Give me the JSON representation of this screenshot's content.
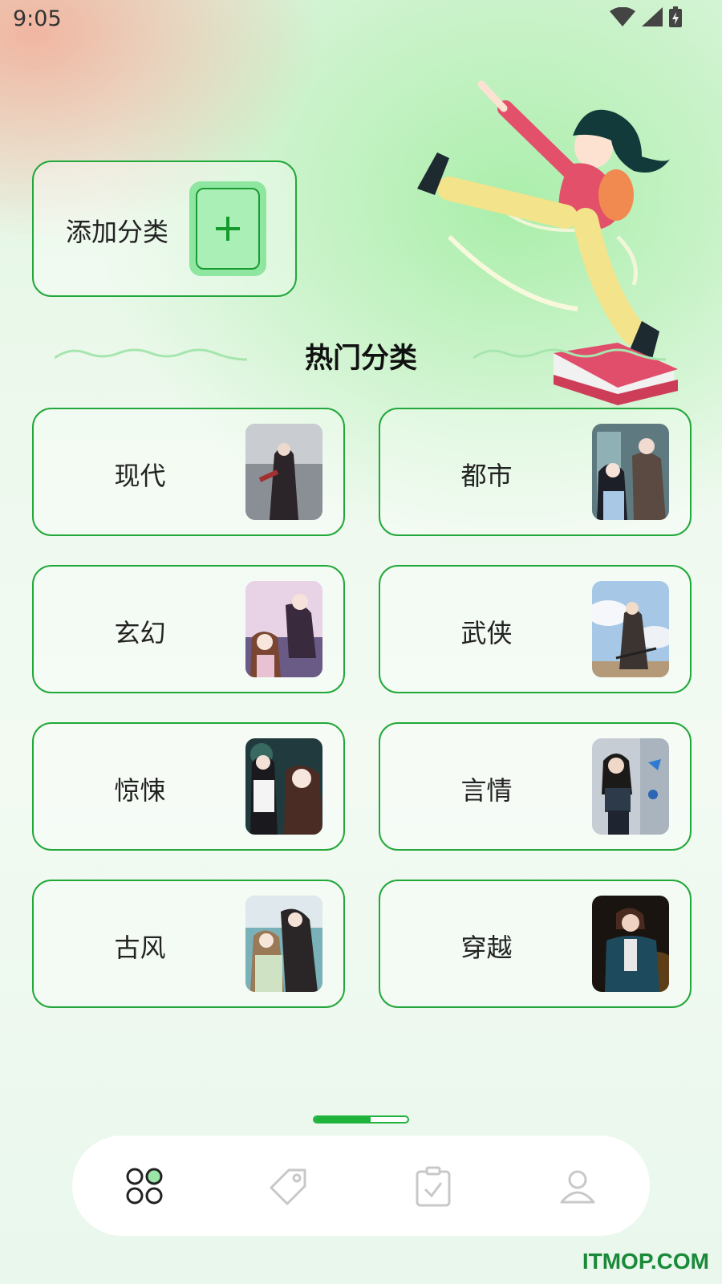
{
  "status_bar": {
    "time": "9:05"
  },
  "add_category": {
    "label": "添加分类",
    "button_symbol": "+"
  },
  "section_title": "热门分类",
  "categories": [
    {
      "label": "现代"
    },
    {
      "label": "都市"
    },
    {
      "label": "玄幻"
    },
    {
      "label": "武侠"
    },
    {
      "label": "惊悚"
    },
    {
      "label": "言情"
    },
    {
      "label": "古风"
    },
    {
      "label": "穿越"
    }
  ],
  "pager": {
    "progress": 0.6
  },
  "tabbar": {
    "tabs": [
      {
        "icon": "categories-icon",
        "active": true
      },
      {
        "icon": "tag-icon",
        "active": false
      },
      {
        "icon": "clipboard-check-icon",
        "active": false
      },
      {
        "icon": "user-icon",
        "active": false
      }
    ]
  },
  "watermark": "ITMOP.COM",
  "colors": {
    "accent": "#22a83a",
    "accent_light": "#8fe6a1",
    "tab_inactive": "#c8c8c8"
  }
}
